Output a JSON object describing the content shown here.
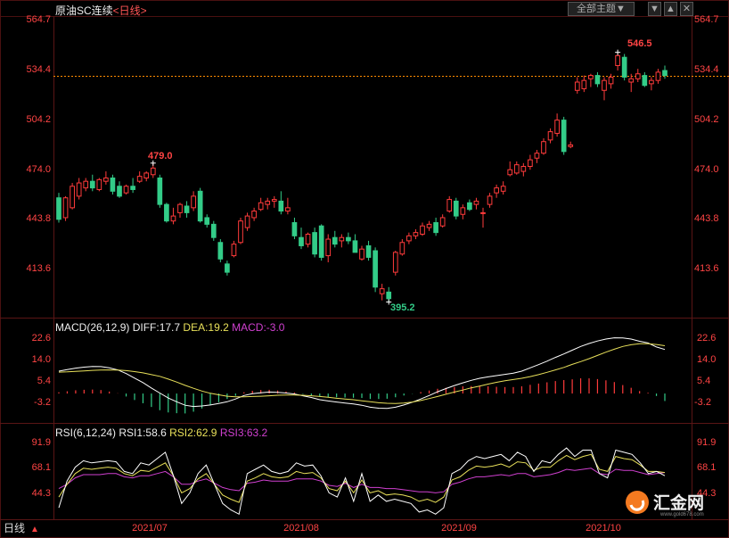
{
  "header": {
    "instrument": "原油SC连续",
    "period": "<日线>",
    "theme_button": "全部主题▼",
    "controls": [
      "▼",
      "▲"
    ],
    "close_icon": "close-icon"
  },
  "price_axis": {
    "ticks": [
      "564.7",
      "534.4",
      "504.2",
      "474.0",
      "443.8",
      "413.6"
    ],
    "hline_value": 531.5,
    "max_label": "546.5",
    "min_label": "395.2",
    "peak_label": "479.0"
  },
  "macd": {
    "title": "MACD(26,12,9)",
    "diff_label": "DIFF:17.7",
    "dea_label": "DEA:19.2",
    "macd_label": "MACD:-3.0",
    "ticks": [
      "22.6",
      "14.0",
      "5.4",
      "-3.2"
    ]
  },
  "rsi": {
    "title": "RSI(6,12,24)",
    "rsi1_label": "RSI1:58.6",
    "rsi2_label": "RSI2:62.9",
    "rsi3_label": "RSI3:63.2",
    "ticks": [
      "91.9",
      "68.1",
      "44.3"
    ]
  },
  "time_axis": {
    "labels": [
      "2021/07",
      "2021/08",
      "2021/09",
      "2021/10"
    ]
  },
  "footer": {
    "period_label": "日线",
    "arrow": "▲",
    "watermark_text": "汇金网",
    "watermark_url": "www.gold678.com"
  },
  "colors": {
    "up": "#ff3b3b",
    "down": "#33cc88",
    "diff": "#ffffff",
    "dea": "#e8e05a",
    "rsi3": "#d040d0",
    "axis_text": "#ff4444",
    "hline": "#ff8c00"
  },
  "chart_data": [
    {
      "type": "candlestick",
      "title": "原油SC连续",
      "ylim": [
        395,
        565
      ],
      "extremes": {
        "high": 546.5,
        "low": 395.2
      },
      "candles": [
        {
          "o": 458,
          "h": 461,
          "l": 443,
          "c": 445
        },
        {
          "o": 446,
          "h": 459,
          "l": 444,
          "c": 458
        },
        {
          "o": 452,
          "h": 467,
          "l": 451,
          "c": 465
        },
        {
          "o": 459,
          "h": 470,
          "l": 457,
          "c": 467
        },
        {
          "o": 464,
          "h": 470,
          "l": 462,
          "c": 468
        },
        {
          "o": 468,
          "h": 472,
          "l": 462,
          "c": 464
        },
        {
          "o": 463,
          "h": 470,
          "l": 462,
          "c": 469
        },
        {
          "o": 468,
          "h": 474,
          "l": 466,
          "c": 470
        },
        {
          "o": 470,
          "h": 472,
          "l": 460,
          "c": 462
        },
        {
          "o": 465,
          "h": 468,
          "l": 458,
          "c": 459
        },
        {
          "o": 461,
          "h": 466,
          "l": 460,
          "c": 465
        },
        {
          "o": 465,
          "h": 470,
          "l": 461,
          "c": 463
        },
        {
          "o": 468,
          "h": 474,
          "l": 467,
          "c": 471
        },
        {
          "o": 470,
          "h": 474,
          "l": 468,
          "c": 473
        },
        {
          "o": 472,
          "h": 479,
          "l": 470,
          "c": 476
        },
        {
          "o": 470,
          "h": 472,
          "l": 452,
          "c": 454
        },
        {
          "o": 454,
          "h": 455,
          "l": 443,
          "c": 444
        },
        {
          "o": 444,
          "h": 452,
          "l": 442,
          "c": 447
        },
        {
          "o": 449,
          "h": 455,
          "l": 446,
          "c": 454
        },
        {
          "o": 453,
          "h": 456,
          "l": 446,
          "c": 449
        },
        {
          "o": 452,
          "h": 462,
          "l": 450,
          "c": 459
        },
        {
          "o": 462,
          "h": 464,
          "l": 443,
          "c": 444
        },
        {
          "o": 446,
          "h": 448,
          "l": 440,
          "c": 442
        },
        {
          "o": 442,
          "h": 444,
          "l": 432,
          "c": 434
        },
        {
          "o": 431,
          "h": 433,
          "l": 419,
          "c": 421
        },
        {
          "o": 418,
          "h": 420,
          "l": 411,
          "c": 413
        },
        {
          "o": 423,
          "h": 432,
          "l": 422,
          "c": 430
        },
        {
          "o": 431,
          "h": 446,
          "l": 430,
          "c": 444
        },
        {
          "o": 440,
          "h": 449,
          "l": 438,
          "c": 447
        },
        {
          "o": 446,
          "h": 452,
          "l": 444,
          "c": 450
        },
        {
          "o": 451,
          "h": 458,
          "l": 450,
          "c": 455
        },
        {
          "o": 454,
          "h": 458,
          "l": 451,
          "c": 456
        },
        {
          "o": 456,
          "h": 459,
          "l": 452,
          "c": 457
        },
        {
          "o": 456,
          "h": 462,
          "l": 448,
          "c": 450
        },
        {
          "o": 450,
          "h": 458,
          "l": 448,
          "c": 452
        },
        {
          "o": 443,
          "h": 446,
          "l": 433,
          "c": 435
        },
        {
          "o": 434,
          "h": 440,
          "l": 427,
          "c": 429
        },
        {
          "o": 430,
          "h": 437,
          "l": 428,
          "c": 436
        },
        {
          "o": 437,
          "h": 440,
          "l": 422,
          "c": 424
        },
        {
          "o": 441,
          "h": 442,
          "l": 420,
          "c": 422
        },
        {
          "o": 423,
          "h": 436,
          "l": 419,
          "c": 433
        },
        {
          "o": 434,
          "h": 438,
          "l": 428,
          "c": 430
        },
        {
          "o": 432,
          "h": 436,
          "l": 428,
          "c": 434
        },
        {
          "o": 434,
          "h": 437,
          "l": 430,
          "c": 432
        },
        {
          "o": 432,
          "h": 436,
          "l": 425,
          "c": 425
        },
        {
          "o": 421,
          "h": 429,
          "l": 420,
          "c": 427
        },
        {
          "o": 429,
          "h": 432,
          "l": 420,
          "c": 422
        },
        {
          "o": 426,
          "h": 428,
          "l": 401,
          "c": 404
        },
        {
          "o": 400,
          "h": 406,
          "l": 396,
          "c": 403
        },
        {
          "o": 401,
          "h": 404,
          "l": 395,
          "c": 397
        },
        {
          "o": 413,
          "h": 426,
          "l": 411,
          "c": 425
        },
        {
          "o": 424,
          "h": 433,
          "l": 423,
          "c": 431
        },
        {
          "o": 432,
          "h": 437,
          "l": 430,
          "c": 435
        },
        {
          "o": 435,
          "h": 439,
          "l": 433,
          "c": 437
        },
        {
          "o": 436,
          "h": 443,
          "l": 435,
          "c": 441
        },
        {
          "o": 440,
          "h": 444,
          "l": 438,
          "c": 442
        },
        {
          "o": 443,
          "h": 446,
          "l": 435,
          "c": 437
        },
        {
          "o": 441,
          "h": 448,
          "l": 440,
          "c": 446
        },
        {
          "o": 450,
          "h": 459,
          "l": 449,
          "c": 457
        },
        {
          "o": 456,
          "h": 458,
          "l": 445,
          "c": 447
        },
        {
          "o": 448,
          "h": 454,
          "l": 445,
          "c": 452
        },
        {
          "o": 455,
          "h": 457,
          "l": 450,
          "c": 451
        },
        {
          "o": 454,
          "h": 458,
          "l": 451,
          "c": 456
        },
        {
          "o": 449,
          "h": 452,
          "l": 440,
          "c": 449
        },
        {
          "o": 454,
          "h": 461,
          "l": 452,
          "c": 459
        },
        {
          "o": 461,
          "h": 466,
          "l": 458,
          "c": 464
        },
        {
          "o": 462,
          "h": 468,
          "l": 460,
          "c": 465
        },
        {
          "o": 472,
          "h": 480,
          "l": 471,
          "c": 475
        },
        {
          "o": 473,
          "h": 480,
          "l": 472,
          "c": 478
        },
        {
          "o": 474,
          "h": 479,
          "l": 471,
          "c": 477
        },
        {
          "o": 477,
          "h": 484,
          "l": 475,
          "c": 481
        },
        {
          "o": 482,
          "h": 487,
          "l": 479,
          "c": 485
        },
        {
          "o": 485,
          "h": 494,
          "l": 484,
          "c": 492
        },
        {
          "o": 493,
          "h": 500,
          "l": 491,
          "c": 498
        },
        {
          "o": 497,
          "h": 509,
          "l": 495,
          "c": 505
        },
        {
          "o": 505,
          "h": 507,
          "l": 484,
          "c": 486
        },
        {
          "o": 489,
          "h": 492,
          "l": 488,
          "c": 490
        },
        {
          "o": 523,
          "h": 531,
          "l": 521,
          "c": 528
        },
        {
          "o": 524,
          "h": 532,
          "l": 522,
          "c": 529
        },
        {
          "o": 530,
          "h": 533,
          "l": 525,
          "c": 532
        },
        {
          "o": 532,
          "h": 534,
          "l": 525,
          "c": 527
        },
        {
          "o": 523,
          "h": 531,
          "l": 517,
          "c": 529
        },
        {
          "o": 527,
          "h": 533,
          "l": 524,
          "c": 531
        },
        {
          "o": 538,
          "h": 546,
          "l": 535,
          "c": 544
        },
        {
          "o": 543,
          "h": 545,
          "l": 529,
          "c": 531
        },
        {
          "o": 528,
          "h": 533,
          "l": 522,
          "c": 530
        },
        {
          "o": 530,
          "h": 536,
          "l": 528,
          "c": 533
        },
        {
          "o": 532,
          "h": 534,
          "l": 525,
          "c": 526
        },
        {
          "o": 527,
          "h": 531,
          "l": 523,
          "c": 529
        },
        {
          "o": 529,
          "h": 536,
          "l": 527,
          "c": 534
        },
        {
          "o": 535,
          "h": 538,
          "l": 530,
          "c": 532
        }
      ]
    },
    {
      "type": "line",
      "title": "MACD(26,12,9)",
      "ylim": [
        -3.2,
        22.6
      ],
      "series": [
        {
          "name": "DIFF",
          "values": [
            9,
            9.6,
            10.2,
            10.6,
            10.9,
            10.8,
            10.3,
            9.5,
            8,
            6.2,
            4.4,
            2.2,
            0.2,
            -1.8,
            -3.3,
            -4.7,
            -5.2,
            -5,
            -4.6,
            -4,
            -3.3,
            -2.2,
            -0.8,
            -0.1,
            0.3,
            0.6,
            0.5,
            0.2,
            -0.2,
            -0.9,
            -1.6,
            -2.5,
            -3,
            -3.4,
            -3.8,
            -4.2,
            -4.7,
            -5.5,
            -5.9,
            -6,
            -5.5,
            -4.6,
            -3.5,
            -2.2,
            -0.8,
            0.7,
            2,
            3.2,
            4.3,
            5.3,
            6.1,
            6.7,
            7.2,
            7.7,
            8.2,
            9,
            10.3,
            11.6,
            13,
            14.5,
            15.9,
            17.4,
            18.9,
            20.1,
            21.1,
            21.9,
            22.4,
            22.3,
            21.9,
            21,
            20.3,
            18.7,
            17.7
          ]
        },
        {
          "name": "DEA",
          "values": [
            8.6,
            8.7,
            8.9,
            9.1,
            9.3,
            9.4,
            9.5,
            9.4,
            9.2,
            8.8,
            8.3,
            7.6,
            6.9,
            5.8,
            4.6,
            3.3,
            2.1,
            1,
            0.1,
            -0.5,
            -1.1,
            -1.3,
            -1.3,
            -1.2,
            -1.1,
            -0.9,
            -0.7,
            -0.6,
            -0.6,
            -0.7,
            -0.9,
            -1.2,
            -1.5,
            -1.9,
            -2.2,
            -2.5,
            -2.9,
            -3.3,
            -3.7,
            -3.9,
            -4,
            -3.8,
            -3.4,
            -2.8,
            -2,
            -1.2,
            -0.3,
            0.6,
            1.4,
            2.3,
            3,
            3.8,
            4.5,
            5.1,
            5.6,
            6.1,
            6.8,
            7.6,
            8.5,
            9.5,
            10.5,
            11.7,
            12.8,
            14,
            15.3,
            16.6,
            17.8,
            18.9,
            19.6,
            20,
            20,
            19.7,
            19.2
          ]
        },
        {
          "name": "MACD",
          "values": [
            0.5,
            0.9,
            1.3,
            1.5,
            1.6,
            1.4,
            0.8,
            0.1,
            -1.2,
            -2.6,
            -3.9,
            -5.4,
            -6.7,
            -7.6,
            -7.9,
            -8,
            -7.3,
            -6,
            -4.7,
            -3.5,
            -2.2,
            -0.9,
            0.5,
            1.1,
            1.4,
            1.5,
            1.2,
            0.8,
            0.4,
            -0.2,
            -0.7,
            -1.3,
            -1.5,
            -1.5,
            -1.6,
            -1.7,
            -1.8,
            -2.2,
            -2.2,
            -2.1,
            -1.5,
            -0.8,
            -0.1,
            0.6,
            1.2,
            1.9,
            2.3,
            2.6,
            2.9,
            3,
            3.1,
            2.9,
            2.7,
            2.6,
            2.6,
            2.9,
            3.5,
            4,
            4.5,
            5,
            5.4,
            5.7,
            6.1,
            6.1,
            5.8,
            5.3,
            4.6,
            3.4,
            2.3,
            1,
            0.3,
            -1,
            -3
          ]
        }
      ]
    },
    {
      "type": "line",
      "title": "RSI(6,12,24)",
      "ylim": [
        25,
        95
      ],
      "series": [
        {
          "name": "RSI1",
          "values": [
            30,
            55,
            68,
            74,
            72,
            73,
            74,
            73,
            64,
            62,
            72,
            70,
            76,
            82,
            60,
            34,
            44,
            62,
            70,
            52,
            34,
            28,
            24,
            62,
            66,
            70,
            64,
            62,
            64,
            72,
            69,
            70,
            60,
            44,
            40,
            58,
            36,
            62,
            36,
            42,
            36,
            38,
            36,
            34,
            26,
            28,
            24,
            30,
            62,
            66,
            74,
            78,
            76,
            78,
            80,
            74,
            82,
            78,
            64,
            74,
            72,
            80,
            86,
            78,
            84,
            84,
            62,
            58,
            84,
            82,
            80,
            72,
            62,
            64,
            60
          ]
        },
        {
          "name": "RSI2",
          "values": [
            40,
            52,
            62,
            67,
            66,
            67,
            68,
            67,
            62,
            60,
            65,
            64,
            68,
            72,
            60,
            44,
            48,
            57,
            62,
            52,
            42,
            38,
            35,
            55,
            58,
            62,
            59,
            58,
            59,
            64,
            62,
            63,
            58,
            48,
            46,
            55,
            44,
            56,
            44,
            46,
            42,
            43,
            42,
            40,
            36,
            38,
            35,
            40,
            56,
            59,
            65,
            69,
            68,
            69,
            71,
            68,
            73,
            72,
            65,
            68,
            68,
            74,
            79,
            75,
            78,
            80,
            66,
            64,
            78,
            76,
            75,
            70,
            64,
            64,
            63
          ]
        },
        {
          "name": "RSI3",
          "values": [
            48,
            52,
            58,
            61,
            61,
            61,
            62,
            62,
            59,
            58,
            60,
            60,
            62,
            64,
            59,
            52,
            52,
            55,
            57,
            53,
            49,
            47,
            46,
            53,
            54,
            56,
            55,
            55,
            55,
            57,
            57,
            57,
            55,
            51,
            50,
            53,
            49,
            52,
            49,
            49,
            48,
            48,
            47,
            46,
            45,
            45,
            44,
            45,
            52,
            54,
            57,
            59,
            59,
            60,
            61,
            60,
            62,
            62,
            59,
            60,
            61,
            63,
            66,
            65,
            66,
            67,
            62,
            61,
            66,
            65,
            65,
            63,
            61,
            62,
            63
          ]
        }
      ]
    }
  ]
}
